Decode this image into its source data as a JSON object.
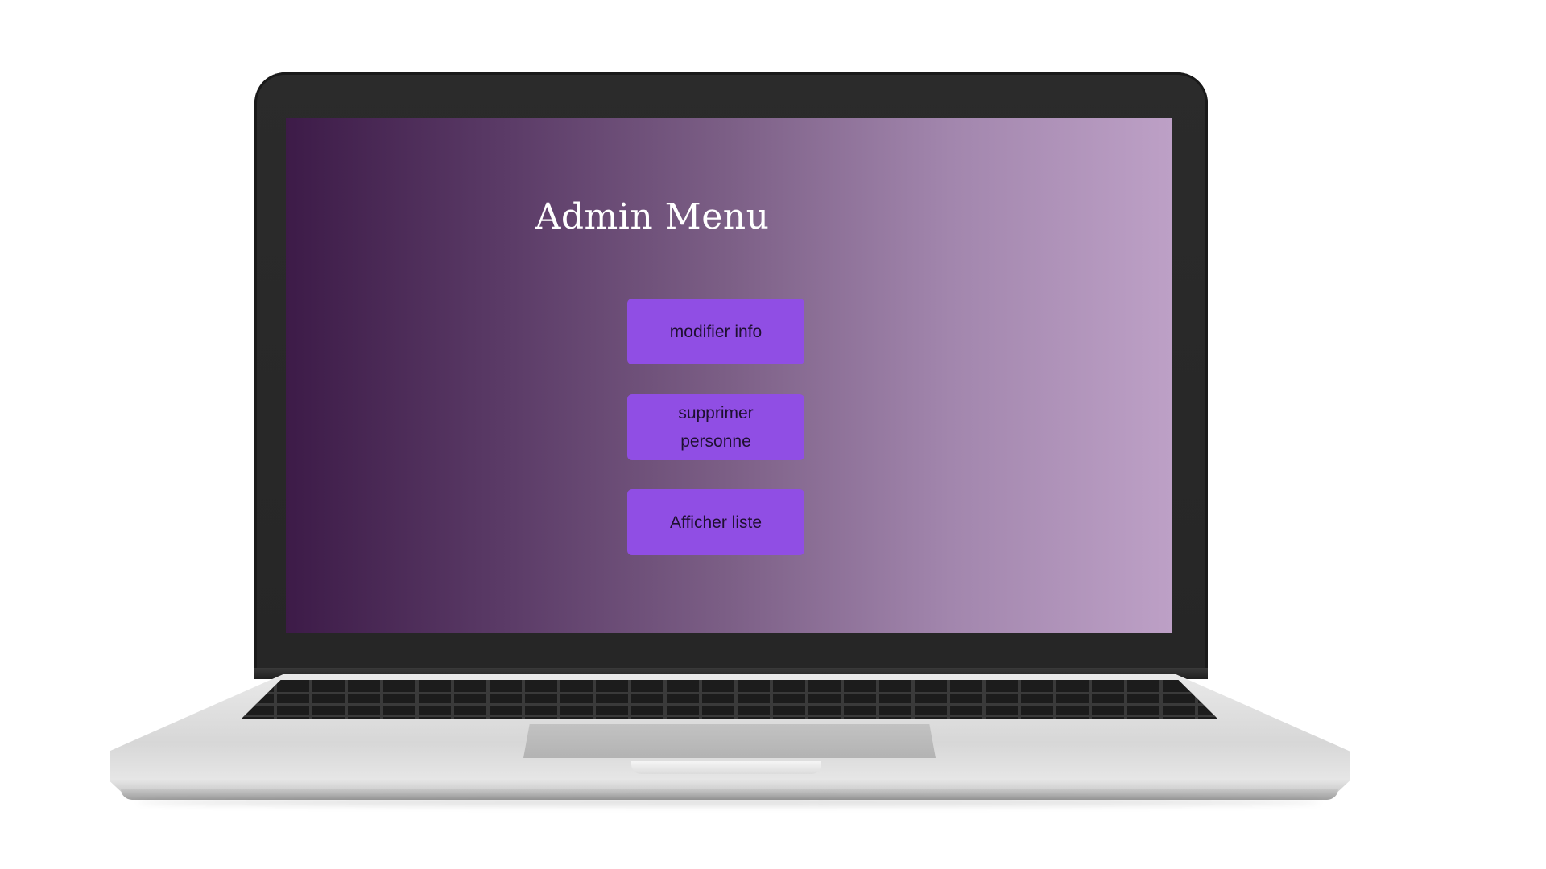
{
  "page": {
    "title": "Admin Menu"
  },
  "menu": {
    "buttons": [
      {
        "label": "modifier info"
      },
      {
        "label": "supprimer personne"
      },
      {
        "label": "Afficher liste"
      }
    ]
  },
  "colors": {
    "screen_gradient_start": "#3d1b48",
    "screen_gradient_end": "#bda0c6",
    "button_fill": "#904ee4",
    "button_text": "#1e1030",
    "title_text": "#ffffff"
  }
}
